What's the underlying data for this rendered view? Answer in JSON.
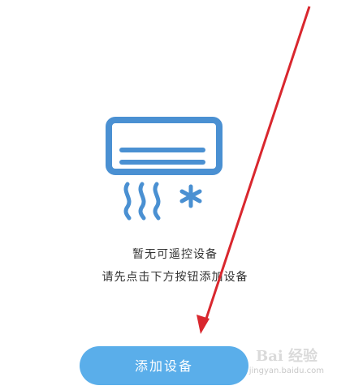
{
  "empty_state": {
    "icon": "air-conditioner-icon",
    "title": "暂无可遥控设备",
    "hint": "请先点击下方按钮添加设备"
  },
  "actions": {
    "add_device_label": "添加设备"
  },
  "colors": {
    "accent": "#5aaeea",
    "icon": "#4a90d2",
    "text": "#333333",
    "arrow": "#d9272e"
  },
  "watermark": {
    "mark": "Bai 经验",
    "text": "jingyan.baidu.com"
  }
}
